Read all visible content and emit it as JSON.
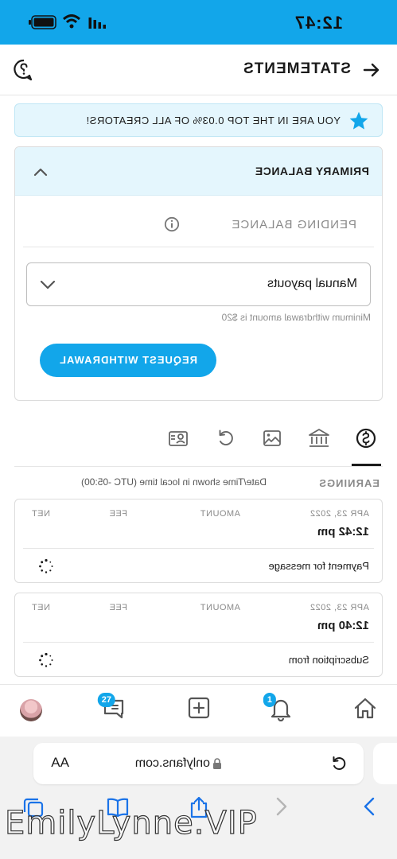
{
  "status_bar": {
    "time": "12:47"
  },
  "header": {
    "title": "STATEMENTS"
  },
  "banner": {
    "text": "YOU ARE IN THE TOP 0.03% OF ALL CREATORS!"
  },
  "balance": {
    "primary_label": "PRIMARY BALANCE",
    "pending_label": "PENDING BALANCE",
    "payout_method": "Manual payouts",
    "min_note": "Minimum withdrawal amount is $20",
    "withdraw_label": "REQUEST WITHDRAWAL"
  },
  "tabs": [
    {
      "icon": "dollar-circle-icon",
      "active": true
    },
    {
      "icon": "bank-icon"
    },
    {
      "icon": "image-icon"
    },
    {
      "icon": "refund-icon"
    },
    {
      "icon": "referral-icon"
    }
  ],
  "earnings": {
    "label": "EARNINGS",
    "timezone_note": "Date/Time shown in local time (UTC -05:00)",
    "columns": {
      "amount": "AMOUNT",
      "fee": "FEE",
      "net": "NET"
    },
    "transactions": [
      {
        "date": "APR 23, 2022",
        "time": "12:42 pm",
        "description": "Payment for message"
      },
      {
        "date": "APR 23, 2022",
        "time": "12:40 pm",
        "description": "Subscription from"
      }
    ]
  },
  "bottom_nav": {
    "notifications_badge": "1",
    "messages_badge": "27"
  },
  "browser": {
    "url": "onlyfans.com",
    "text_size": "AA"
  },
  "watermark": "EmilyLynne.VIP",
  "colors": {
    "accent": "#12a6ea",
    "banner_bg": "#e4f6fd"
  }
}
